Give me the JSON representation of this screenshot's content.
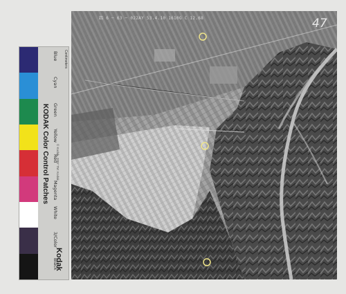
{
  "color_patches": [
    {
      "label": "Blue",
      "color": "#2c2a73"
    },
    {
      "label": "Cyan",
      "color": "#2a8fd6"
    },
    {
      "label": "Green",
      "color": "#1d8a4e"
    },
    {
      "label": "Yellow",
      "color": "#f2e21a"
    },
    {
      "label": "Red",
      "color": "#d62f36"
    },
    {
      "label": "Magenta",
      "color": "#d23a7c"
    },
    {
      "label": "White",
      "color": "#ffffff"
    },
    {
      "label": "3/Color",
      "color": "#3a2f48"
    },
    {
      "label": "Black",
      "color": "#151515"
    }
  ],
  "target_title": "KODAK Color Control Patches",
  "target_brand": "Kodak",
  "ruler_label": "Centimeters",
  "fine_print": "© Kodak, 2007  TM: Kodak",
  "photo": {
    "header_text": "四 6 ─ 63 ─ 022AY  53.4.10  1610G  C  12.68",
    "frame_number": "47"
  }
}
